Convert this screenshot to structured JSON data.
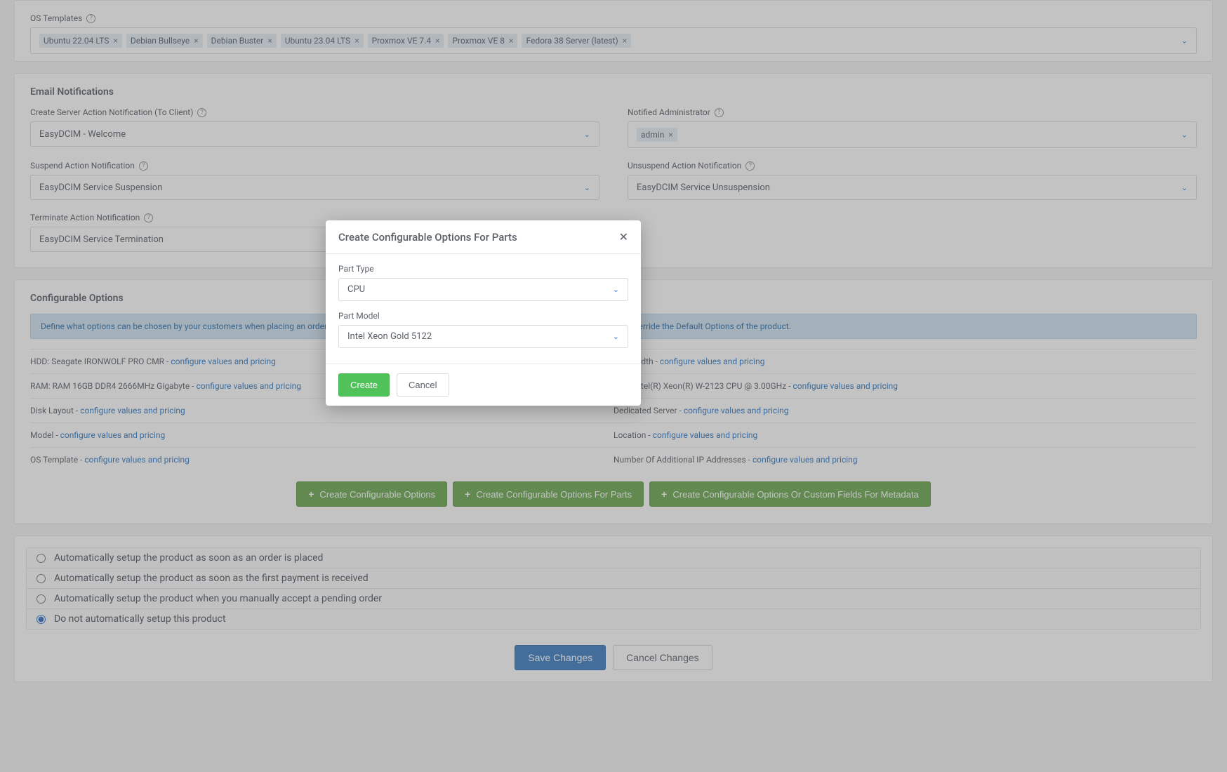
{
  "os_templates": {
    "label": "OS Templates",
    "tags": [
      "Ubuntu 22.04 LTS",
      "Debian Bullseye",
      "Debian Buster",
      "Ubuntu 23.04 LTS",
      "Proxmox VE 7.4",
      "Proxmox VE 8",
      "Fedora 38 Server (latest)"
    ]
  },
  "email_section": {
    "title": "Email Notifications",
    "create_label": "Create Server Action Notification (To Client)",
    "create_value": "EasyDCIM - Welcome",
    "admin_label": "Notified Administrator",
    "admin_tags": [
      "admin"
    ],
    "suspend_label": "Suspend Action Notification",
    "suspend_value": "EasyDCIM Service Suspension",
    "unsuspend_label": "Unsuspend Action Notification",
    "unsuspend_value": "EasyDCIM Service Unsuspension",
    "terminate_label": "Terminate Action Notification",
    "terminate_value": "EasyDCIM Service Termination"
  },
  "config_section": {
    "title": "Configurable Options",
    "banner": "Define what options can be chosen by your customers when placing an order. You can define the 'Configurable Options' for the product here. These values will override the Default Options of the product.",
    "link_text": "configure values and pricing",
    "left": [
      {
        "prefix": "HDD: Seagate IRONWOLF PRO CMR - "
      },
      {
        "prefix": "RAM: RAM 16GB DDR4 2666MHz Gigabyte - "
      },
      {
        "prefix": "Disk Layout - "
      },
      {
        "prefix": "Model - "
      },
      {
        "prefix": "OS Template - "
      }
    ],
    "right": [
      {
        "prefix": "Bandwidth - "
      },
      {
        "prefix": "CPU: Intel(R) Xeon(R) W-2123 CPU @ 3.00GHz - "
      },
      {
        "prefix": "Dedicated Server - "
      },
      {
        "prefix": "Location - "
      },
      {
        "prefix": "Number Of Additional IP Addresses - "
      }
    ],
    "btn1": "Create Configurable Options",
    "btn2": "Create Configurable Options For Parts",
    "btn3": "Create Configurable Options Or Custom Fields For Metadata"
  },
  "auto_setup": {
    "options": [
      "Automatically setup the product as soon as an order is placed",
      "Automatically setup the product as soon as the first payment is received",
      "Automatically setup the product when you manually accept a pending order",
      "Do not automatically setup this product"
    ],
    "selected_index": 3
  },
  "footer": {
    "save": "Save Changes",
    "cancel": "Cancel Changes"
  },
  "modal": {
    "title": "Create Configurable Options For Parts",
    "part_type_label": "Part Type",
    "part_type_value": "CPU",
    "part_model_label": "Part Model",
    "part_model_value": "Intel Xeon Gold 5122",
    "create": "Create",
    "cancel": "Cancel"
  }
}
